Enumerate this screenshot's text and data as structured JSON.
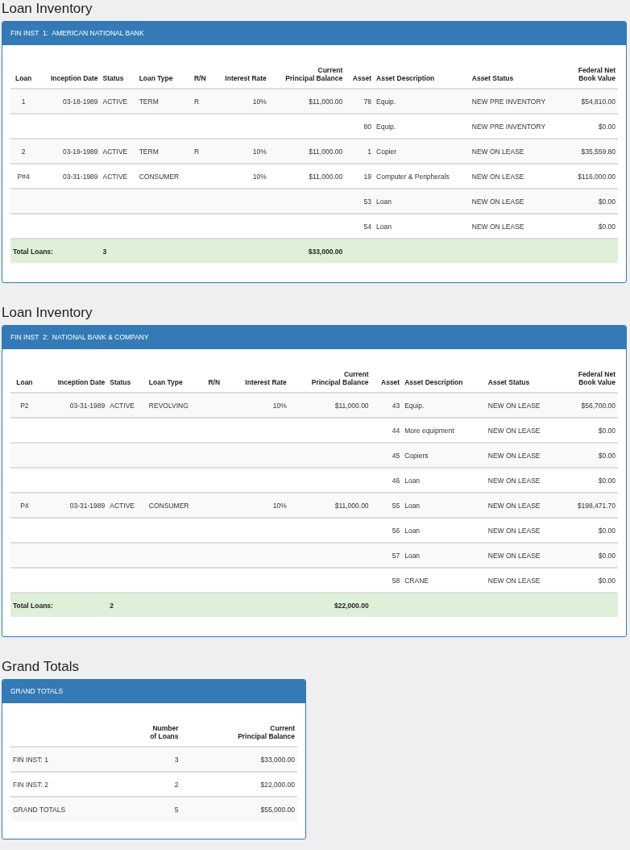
{
  "inventories": [
    {
      "heading": "Loan Inventory",
      "panel_title": "FIN INST  1:  AMERICAN NATIONAL BANK",
      "columns": [
        "Loan",
        "Inception Date",
        "Status",
        "Loan Type",
        "R/N",
        "Interest Rate",
        "Current\nPrincipal Balance",
        "Asset",
        "Asset Description",
        "Asset Status",
        "Federal Net\nBook Value"
      ],
      "rows": [
        {
          "loan": "1",
          "inception_date": "03-18-1989",
          "status": "ACTIVE",
          "loan_type": "TERM",
          "rn": "R",
          "interest_rate": "10%",
          "balance": "$11,000.00",
          "asset": "78",
          "asset_description": "Equip.",
          "asset_status": "NEW PRE INVENTORY",
          "book_value": "$54,810.00"
        },
        {
          "asset": "80",
          "asset_description": "Equip.",
          "asset_status": "NEW PRE INVENTORY",
          "book_value": "$0.00"
        },
        {
          "loan": "2",
          "inception_date": "03-19-1989",
          "status": "ACTIVE",
          "loan_type": "TERM",
          "rn": "R",
          "interest_rate": "10%",
          "balance": "$11,000.00",
          "asset": "1",
          "asset_description": "Copier",
          "asset_status": "NEW ON LEASE",
          "book_value": "$35,559.80"
        },
        {
          "loan": "P#4",
          "inception_date": "03-31-1989",
          "status": "ACTIVE",
          "loan_type": "CONSUMER",
          "interest_rate": "10%",
          "balance": "$11,000.00",
          "asset": "19",
          "asset_description": "Computer & Peripherals",
          "asset_status": "NEW ON LEASE",
          "book_value": "$116,000.00"
        },
        {
          "asset": "53",
          "asset_description": "Loan",
          "asset_status": "NEW ON LEASE",
          "book_value": "$0.00"
        },
        {
          "asset": "54",
          "asset_description": "Loan",
          "asset_status": "NEW ON LEASE",
          "book_value": "$0.00"
        }
      ],
      "total": {
        "label": "Total Loans:",
        "count": "3",
        "balance": "$33,000.00"
      }
    },
    {
      "heading": "Loan Inventory",
      "panel_title": "FIN INST  2:  NATIONAL BANK & COMPANY",
      "columns": [
        "Loan",
        "Inception Date",
        "Status",
        "Loan Type",
        "R/N",
        "Interest Rate",
        "Current\nPrincipal Balance",
        "Asset",
        "Asset Description",
        "Asset Status",
        "Federal Net\nBook Value"
      ],
      "rows": [
        {
          "loan": "P2",
          "inception_date": "03-31-1989",
          "status": "ACTIVE",
          "loan_type": "REVOLVING",
          "interest_rate": "10%",
          "balance": "$11,000.00",
          "asset": "43",
          "asset_description": "Equip.",
          "asset_status": "NEW ON LEASE",
          "book_value": "$56,700.00"
        },
        {
          "asset": "44",
          "asset_description": "More equipment",
          "asset_status": "NEW ON LEASE",
          "book_value": "$0.00"
        },
        {
          "asset": "45",
          "asset_description": "Copiers",
          "asset_status": "NEW ON LEASE",
          "book_value": "$0.00"
        },
        {
          "asset": "46",
          "asset_description": "Loan",
          "asset_status": "NEW ON LEASE",
          "book_value": "$0.00"
        },
        {
          "loan": "P4",
          "inception_date": "03-31-1989",
          "status": "ACTIVE",
          "loan_type": "CONSUMER",
          "interest_rate": "10%",
          "balance": "$11,000.00",
          "asset": "55",
          "asset_description": "Loan",
          "asset_status": "NEW ON LEASE",
          "book_value": "$198,471.70"
        },
        {
          "asset": "56",
          "asset_description": "Loan",
          "asset_status": "NEW ON LEASE",
          "book_value": "$0.00"
        },
        {
          "asset": "57",
          "asset_description": "Loan",
          "asset_status": "NEW ON LEASE",
          "book_value": "$0.00"
        },
        {
          "asset": "58",
          "asset_description": "CRANE",
          "asset_status": "NEW ON LEASE",
          "book_value": "$0.00"
        }
      ],
      "total": {
        "label": "Total Loans:",
        "count": "2",
        "balance": "$22,000.00"
      }
    }
  ],
  "grand_totals": {
    "heading": "Grand Totals",
    "panel_title": "GRAND TOTALS",
    "columns": [
      "Number\nof Loans",
      "Current\nPrincipal Balance"
    ],
    "rows": [
      {
        "label": "FIN INST: 1",
        "count": "3",
        "balance": "$33,000.00"
      },
      {
        "label": "FIN INST: 2",
        "count": "2",
        "balance": "$22,000.00"
      },
      {
        "label": "GRAND TOTALS",
        "count": "5",
        "balance": "$55,000.00"
      }
    ]
  }
}
